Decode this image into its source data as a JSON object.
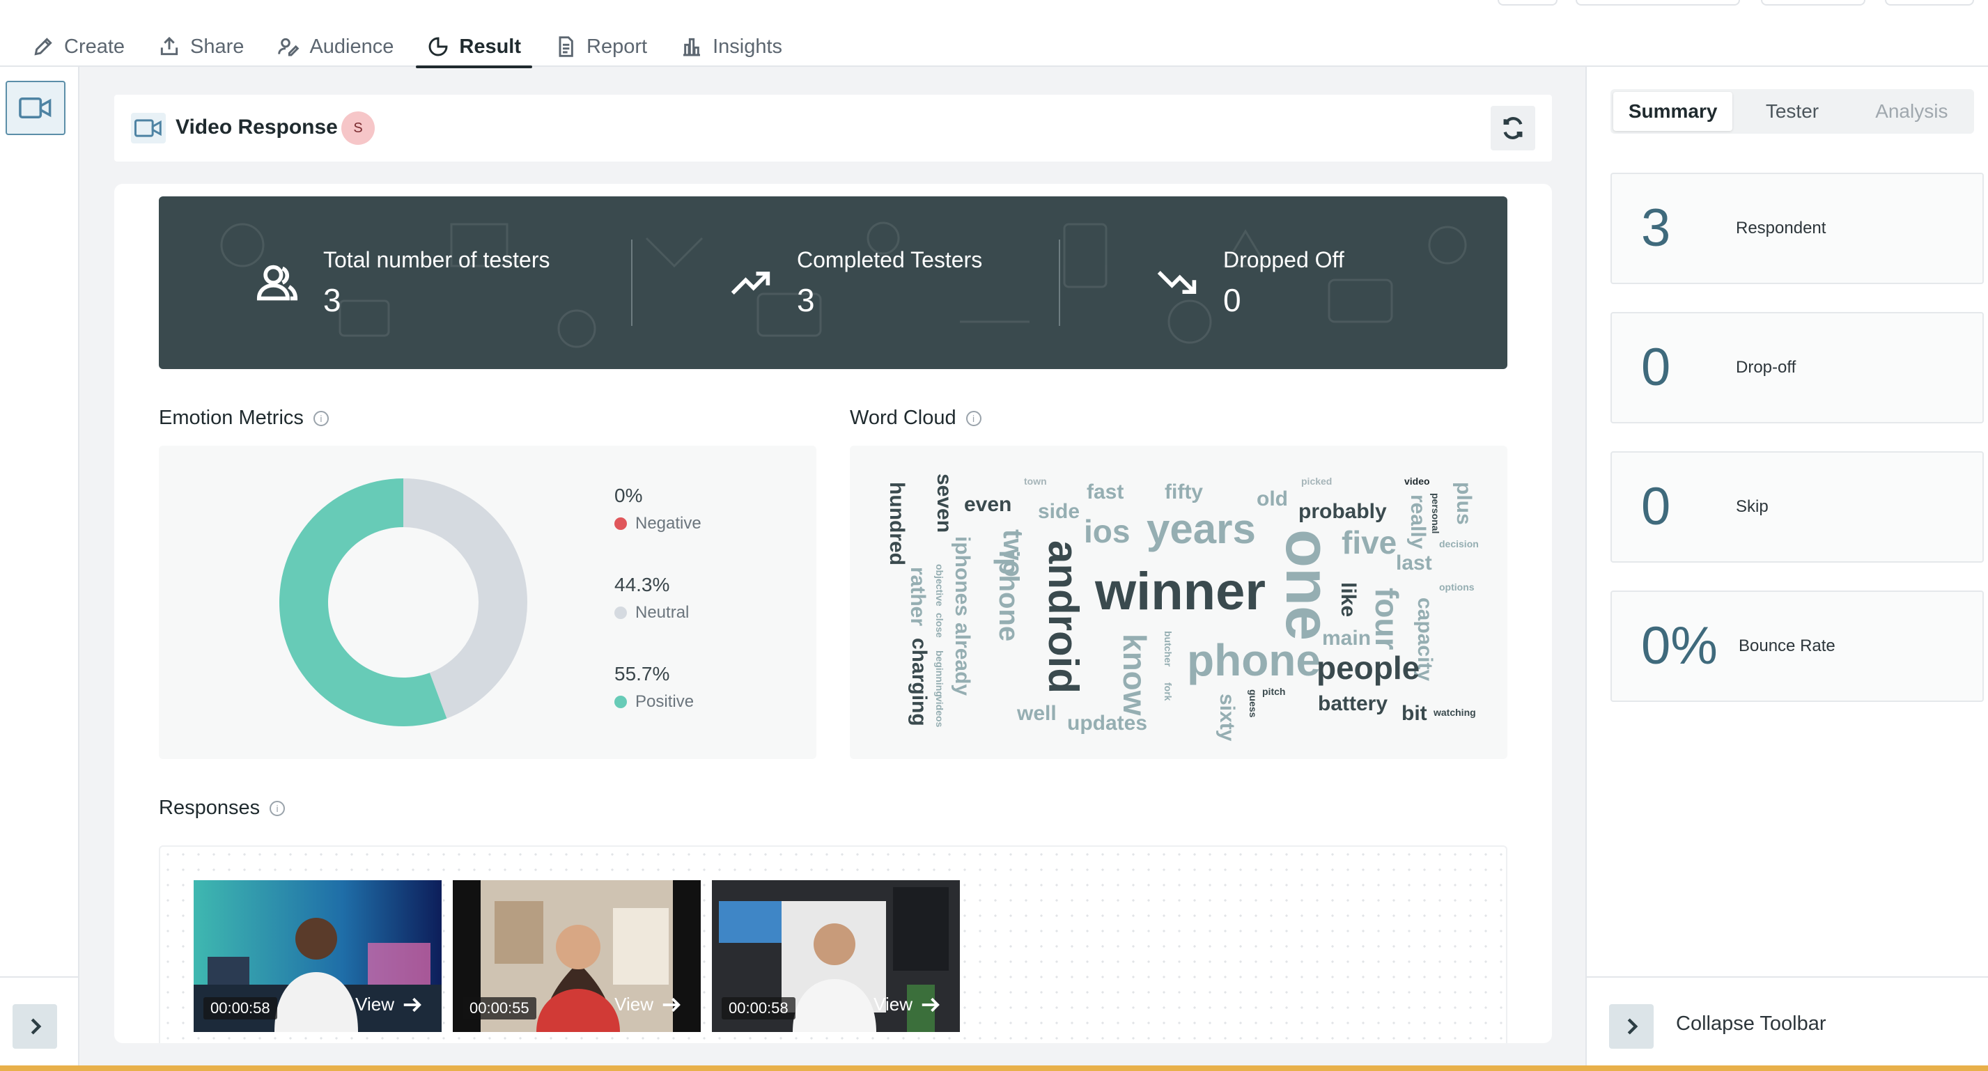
{
  "nav": {
    "tabs": [
      {
        "label": "Create",
        "icon": "pencil-icon"
      },
      {
        "label": "Share",
        "icon": "share-icon"
      },
      {
        "label": "Audience",
        "icon": "audience-icon"
      },
      {
        "label": "Result",
        "icon": "pie-chart-icon",
        "active": true
      },
      {
        "label": "Report",
        "icon": "document-icon"
      },
      {
        "label": "Insights",
        "icon": "bar-chart-icon"
      }
    ]
  },
  "header": {
    "title": "Video Response",
    "badge": "S"
  },
  "stats": {
    "total_label": "Total number of testers",
    "total_value": "3",
    "completed_label": "Completed Testers",
    "completed_value": "3",
    "dropped_label": "Dropped Off",
    "dropped_value": "0"
  },
  "emotion": {
    "title": "Emotion Metrics",
    "items": [
      {
        "pct": "0%",
        "name": "Negative",
        "color": "#e0575b"
      },
      {
        "pct": "44.3%",
        "name": "Neutral",
        "color": "#d5dae0"
      },
      {
        "pct": "55.7%",
        "name": "Positive",
        "color": "#67cbb7"
      }
    ]
  },
  "wordcloud": {
    "title": "Word Cloud",
    "words": [
      "hundred",
      "seven",
      "even",
      "town",
      "fast",
      "fifty",
      "picked",
      "video",
      "plus",
      "rather",
      "objective",
      "iphones",
      "side",
      "two",
      "android",
      "ios",
      "years",
      "old",
      "probably",
      "personal",
      "really",
      "decision",
      "charging",
      "close",
      "already",
      "iphone",
      "winner",
      "one",
      "five",
      "last",
      "options",
      "beginning",
      "videos",
      "know",
      "butcher",
      "fork",
      "phone",
      "main",
      "like",
      "four",
      "capacity",
      "well",
      "updates",
      "sixty",
      "guess",
      "pitch",
      "people",
      "battery",
      "bit",
      "watching"
    ]
  },
  "responses": {
    "title": "Responses",
    "items": [
      {
        "duration": "00:00:58",
        "view": "View"
      },
      {
        "duration": "00:00:55",
        "view": "View"
      },
      {
        "duration": "00:00:58",
        "view": "View"
      }
    ]
  },
  "sidebar": {
    "tabs": [
      "Summary",
      "Tester",
      "Analysis"
    ],
    "metrics": [
      {
        "value": "3",
        "label": "Respondent"
      },
      {
        "value": "0",
        "label": "Drop-off"
      },
      {
        "value": "0",
        "label": "Skip"
      },
      {
        "value": "0%",
        "label": "Bounce Rate"
      }
    ],
    "collapse_label": "Collapse Toolbar"
  },
  "colors": {
    "banner": "#3a4a4e",
    "accent": "#4e83a3",
    "positive": "#67cbb7",
    "neutral": "#d5dae0",
    "negative": "#e0575b"
  }
}
